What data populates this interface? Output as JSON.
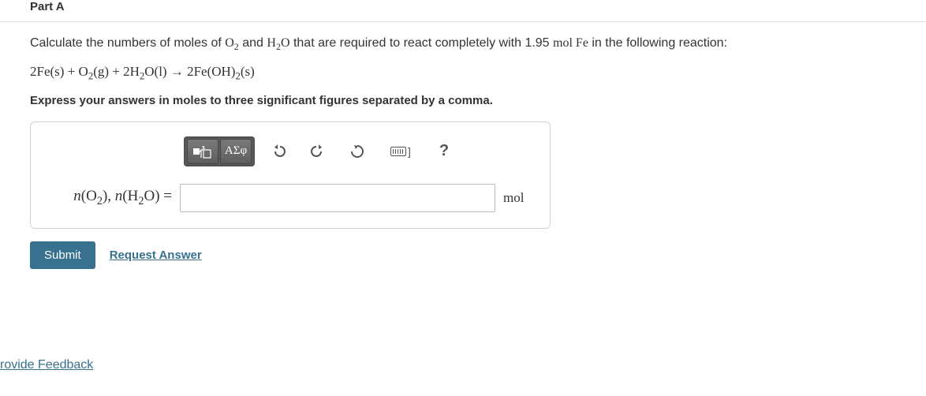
{
  "part_label": "Part A",
  "question": {
    "text_before": "Calculate the numbers of moles of ",
    "o2": "O",
    "o2_sub": "2",
    "and": " and ",
    "h2o_h": "H",
    "h2o_2": "2",
    "h2o_o": "O",
    "text_mid": " that are required to react completely with 1.95 ",
    "mol_fe": "mol",
    "fe": " Fe",
    "text_after": " in the following reaction:"
  },
  "equation": "2Fe(s) + O2(g) + 2H2O(l) → 2Fe(OH)2(s)",
  "equation_parts": {
    "p1": "2Fe(s) + O",
    "p2_sub": "2",
    "p3": "(g) + 2H",
    "p4_sub": "2",
    "p5": "O(l) → 2Fe(OH)",
    "p6_sub": "2",
    "p7": "(s)"
  },
  "instruction": "Express your answers in moles to three significant figures separated by a comma.",
  "toolbar": {
    "template_tool": "template",
    "greek_tool": "ΑΣφ",
    "undo": "undo",
    "redo": "redo",
    "reset": "reset",
    "keyboard": "keyboard",
    "help": "?"
  },
  "input": {
    "label_n": "n",
    "label_o2_o": "O",
    "label_o2_2": "2",
    "label_comma": ", ",
    "label_h2o_h": "H",
    "label_h2o_2": "2",
    "label_h2o_o": "O",
    "label_eq": " =",
    "value": "",
    "unit": "mol"
  },
  "submit_label": "Submit",
  "request_answer_label": "Request Answer",
  "feedback_label": "rovide Feedback"
}
